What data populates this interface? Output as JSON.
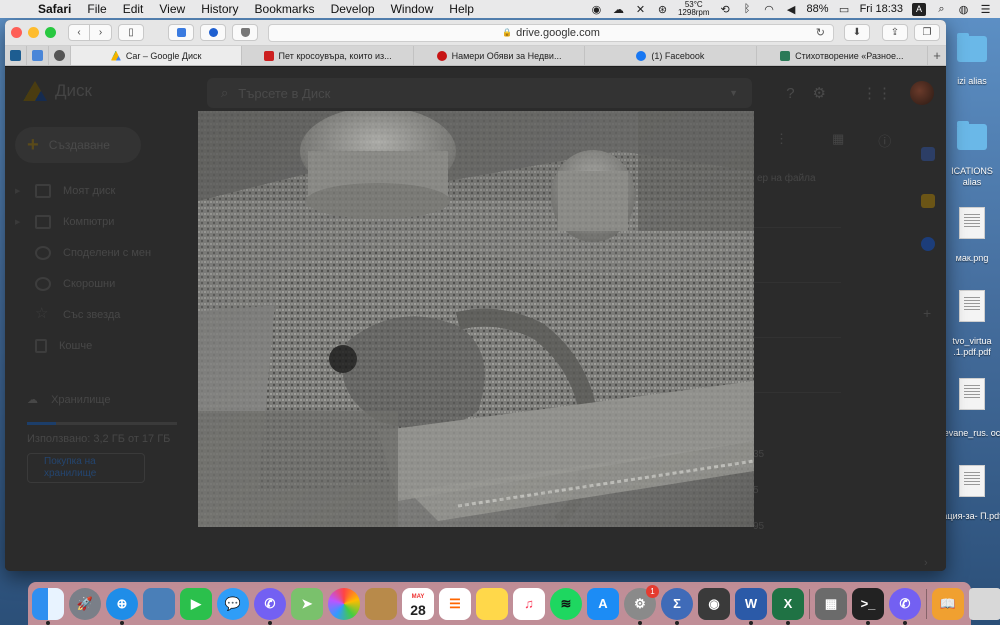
{
  "menubar": {
    "app_name": "Safari",
    "menus": [
      "File",
      "Edit",
      "View",
      "History",
      "Bookmarks",
      "Develop",
      "Window",
      "Help"
    ],
    "temperature": "53°C",
    "fan_speed": "1298rpm",
    "battery": "88%",
    "clock": "Fri 18:33",
    "input_source": "A"
  },
  "browser": {
    "url": "drive.google.com",
    "tabs": [
      {
        "label": "Car – Google Диск",
        "color": "#1a73e8",
        "active": true
      },
      {
        "label": "Пет кросоувъра, които из...",
        "color": "#cc1f1f",
        "active": false
      },
      {
        "label": "Намери Обяви за Недви...",
        "color": "#c71414",
        "active": false
      },
      {
        "label": "(1) Facebook",
        "color": "#1877f2",
        "active": false
      },
      {
        "label": "Стихотворение «Разное...",
        "color": "#2b7a57",
        "active": false
      }
    ]
  },
  "drive": {
    "brand": "Диск",
    "search_placeholder": "Търсете в Диск",
    "create_label": "Създаване",
    "nav": [
      "Моят диск",
      "Компютри",
      "Споделени с мен",
      "Скорошни",
      "Със звезда",
      "Кошче"
    ],
    "storage_title": "Хранилище",
    "storage_used": "Използвано: 3,2 ГБ от 17 ГБ",
    "storage_fraction": 0.19,
    "buy_storage": "Покупка на хранилище",
    "file_name_header": "ер на файла",
    "row_numbers": [
      "35",
      "5",
      "95"
    ]
  },
  "desktop": {
    "items": [
      {
        "label": "izi alias",
        "type": "folder"
      },
      {
        "label": "ICATIONS alias",
        "type": "folder"
      },
      {
        "label": "мак.png",
        "type": "doc"
      },
      {
        "label": "tvo_virtua .1.pdf.pdf",
        "type": "doc"
      },
      {
        "label": "evane_rus. oc",
        "type": "doc"
      },
      {
        "label": "ация-за- П.pdf",
        "type": "doc"
      }
    ]
  },
  "dock": {
    "calendar_month": "MAY",
    "calendar_day": "28",
    "appstore_badge": "1",
    "apps": [
      "finder",
      "launchpad",
      "safari",
      "preview",
      "facetime",
      "messages",
      "viber",
      "maps",
      "photos",
      "contacts",
      "calendar",
      "reminders",
      "notes",
      "music",
      "spotify",
      "app-store",
      "system-preferences",
      "math",
      "screenshot",
      "word",
      "excel",
      "calculator",
      "terminal",
      "viber-2",
      "books",
      "trash"
    ]
  }
}
